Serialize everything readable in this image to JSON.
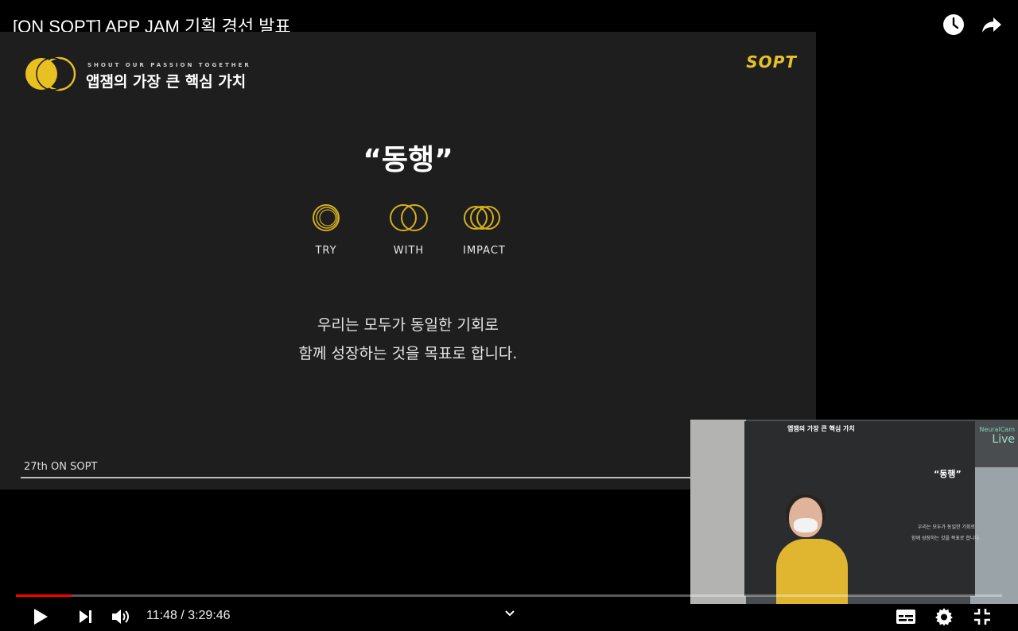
{
  "player": {
    "title": "[ON SOPT] APP JAM 기획 경선 발표",
    "current_time": "11:48",
    "time_separator": "/",
    "duration": "3:29:46",
    "time_display": "11:48 / 3:29:46",
    "progress_fraction": 0.0563,
    "accent_color": "#ff0000"
  },
  "slide": {
    "tagline": "SHOUT OUR PASSION TOGETHER",
    "header": "앱잼의 가장 큰 핵심 가치",
    "brand": "SOPT",
    "quote_title": "“동행”",
    "values": [
      {
        "label": "TRY"
      },
      {
        "label": "WITH"
      },
      {
        "label": "IMPACT"
      }
    ],
    "description_line1": "우리는 모두가 동일한 기회로",
    "description_line2": "함께 성장하는 것을 목표로 합니다.",
    "footer": "27th ON SOPT",
    "brand_color": "#e6c229"
  },
  "camera": {
    "watermark_line1": "NeuralCam",
    "watermark_line2": "Live"
  }
}
